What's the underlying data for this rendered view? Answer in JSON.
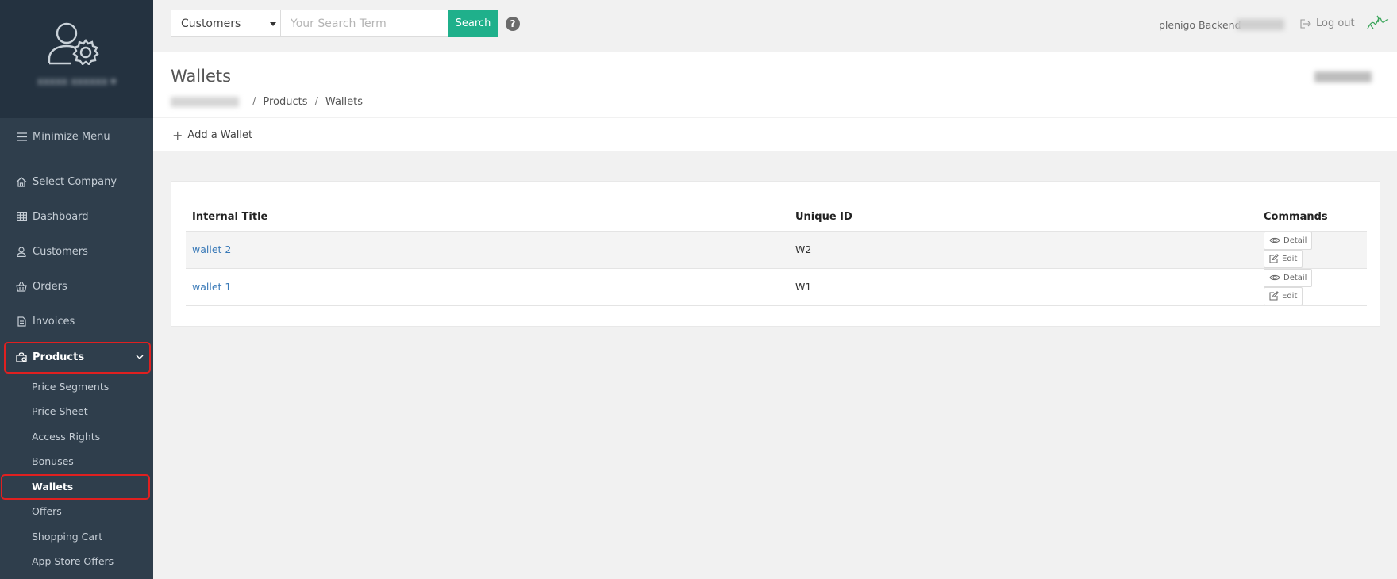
{
  "sidebar": {
    "minimize_label": "Minimize Menu",
    "items": [
      {
        "label": "Select Company"
      },
      {
        "label": "Dashboard"
      },
      {
        "label": "Customers"
      },
      {
        "label": "Orders"
      },
      {
        "label": "Invoices"
      },
      {
        "label": "Products"
      }
    ],
    "sub_items": [
      {
        "label": "Price Segments"
      },
      {
        "label": "Price Sheet"
      },
      {
        "label": "Access Rights"
      },
      {
        "label": "Bonuses"
      },
      {
        "label": "Wallets"
      },
      {
        "label": "Offers"
      },
      {
        "label": "Shopping Cart"
      },
      {
        "label": "App Store Offers"
      }
    ]
  },
  "topbar": {
    "search_scope": "Customers",
    "search_placeholder": "Your Search Term",
    "search_button": "Search",
    "help_label": "?",
    "backend_label": "plenigo Backend",
    "logout_label": "Log out"
  },
  "header": {
    "title": "Wallets",
    "breadcrumb": [
      "Products",
      "Wallets"
    ],
    "breadcrumb_sep": "/"
  },
  "actions": {
    "add_wallet": "Add a Wallet"
  },
  "table": {
    "columns": [
      "Internal Title",
      "Unique ID",
      "Commands"
    ],
    "rows": [
      {
        "title": "wallet 2",
        "id": "W2"
      },
      {
        "title": "wallet 1",
        "id": "W1"
      }
    ],
    "detail_label": "Detail",
    "edit_label": "Edit"
  },
  "colors": {
    "sidebar_bg": "#2f3e4c",
    "accent_green": "#1fb08b",
    "link_blue": "#3a7ab8",
    "highlight_red": "#e02020"
  }
}
